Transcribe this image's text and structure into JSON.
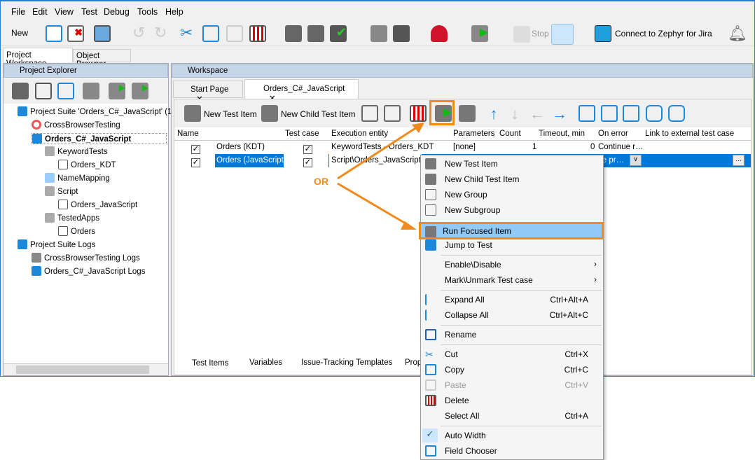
{
  "menu": [
    "File",
    "Edit",
    "View",
    "Test",
    "Debug",
    "Tools",
    "Help"
  ],
  "toolbar": {
    "new": "New",
    "stop": "Stop",
    "connect": "Connect to  Zephyr for Jira"
  },
  "left_tabs": [
    "Project Workspace",
    "Object Browser"
  ],
  "project_explorer": {
    "title": "Project Explorer",
    "tree": [
      "Project Suite 'Orders_C#_JavaScript' (1",
      "CrossBrowserTesting",
      "Orders_C#_JavaScript",
      "KeywordTests",
      "Orders_KDT",
      "NameMapping",
      "Script",
      "Orders_JavaScript",
      "TestedApps",
      "Orders",
      "Project Suite Logs",
      "CrossBrowserTesting Logs",
      "Orders_C#_JavaScript Logs"
    ]
  },
  "workspace": {
    "title": "Workspace",
    "tabs": [
      "Start Page",
      "Orders_C#_JavaScript"
    ],
    "toolbar": {
      "new_test_item": "New Test Item",
      "new_child_test_item": "New Child Test Item"
    },
    "columns": [
      "Name",
      "Test case",
      "Execution entity",
      "Parameters",
      "Count",
      "Timeout, min",
      "On error",
      "Link to external test case"
    ],
    "rows": [
      {
        "name": "Orders (KDT)",
        "test_case": true,
        "entity": "KeywordTests - Orders_KDT",
        "params": "[none]",
        "count": "1",
        "timeout": "0",
        "on_error": "Continue r…",
        "link": ""
      },
      {
        "name": "Orders (JavaScript)",
        "test_case": true,
        "entity": "Script\\Orders_JavaScript - ",
        "params": "",
        "count": "",
        "timeout": "",
        "on_error": "se pr…",
        "link": ""
      }
    ],
    "bottom_tabs": [
      "Test Items",
      "Variables",
      "Issue-Tracking Templates",
      "Prop"
    ]
  },
  "annotation": {
    "or": "OR",
    "color": "#f08a1c"
  },
  "context_menu": [
    {
      "label": "New Test Item"
    },
    {
      "label": "New Child Test Item"
    },
    {
      "label": "New Group"
    },
    {
      "label": "New Subgroup"
    },
    {
      "label": "Run Focused Item",
      "highlighted": true
    },
    {
      "label": "Jump to Test"
    },
    {
      "label": "Enable\\Disable",
      "submenu": true
    },
    {
      "label": "Mark\\Unmark Test case",
      "submenu": true
    },
    {
      "label": "Expand All",
      "shortcut": "Ctrl+Alt+A"
    },
    {
      "label": "Collapse All",
      "shortcut": "Ctrl+Alt+C"
    },
    {
      "label": "Rename"
    },
    {
      "label": "Cut",
      "shortcut": "Ctrl+X"
    },
    {
      "label": "Copy",
      "shortcut": "Ctrl+C"
    },
    {
      "label": "Paste",
      "shortcut": "Ctrl+V",
      "disabled": true
    },
    {
      "label": "Delete"
    },
    {
      "label": "Select All",
      "shortcut": "Ctrl+A"
    },
    {
      "label": "Auto Width",
      "checked": true
    },
    {
      "label": "Field Chooser"
    }
  ]
}
